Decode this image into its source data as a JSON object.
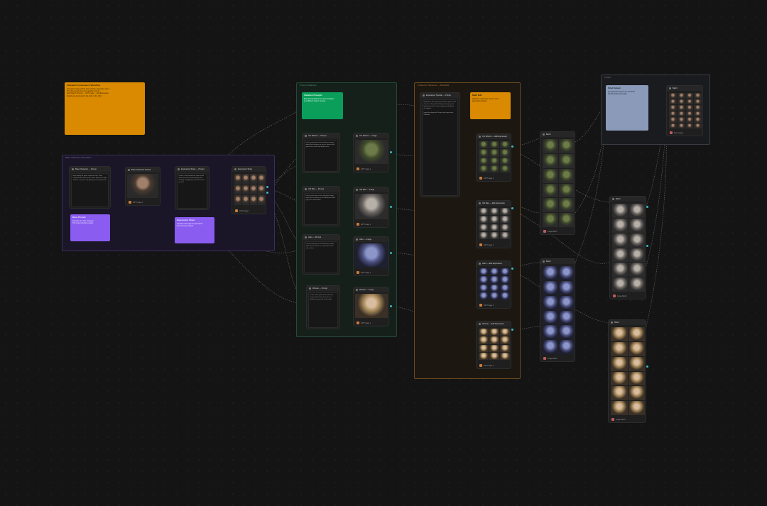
{
  "colors": {
    "background": "#141414",
    "note_orange": "#d98a00",
    "note_green": "#0b9e5a",
    "note_purple": "#8a5cf0",
    "note_blue_gray": "#8a9ab8",
    "group_purple": "#3a2f5a",
    "group_green": "#234a38",
    "group_brown": "#6a4a20",
    "wire": "#8a8a8a",
    "port_cyan": "#3ab8c8"
  },
  "groups": {
    "basic": {
      "title": "Base Character Generation"
    },
    "prompts": {
      "title": "Prompt Variations"
    },
    "edit": {
      "title": "Character Variations — Multi-Edit"
    },
    "output": {
      "title": "Output"
    }
  },
  "notes": {
    "intro": {
      "title": "Character Consistency Workflow",
      "body": "Generate a base portrait, then build an expression sheet.\nThe sheet is fed into every variation prompt.\nEach branch: Prompt → GPT Image → Edit Expression.\nResults are previewed in the grids on the right."
    },
    "base_note_a": {
      "title": "Base Prompt",
      "body": "Describe the main character.\nThis prompt defines identity."
    },
    "base_note_b": {
      "title": "Expression Sheet",
      "body": "Create the 3x4 grid of expressions\nfrom the base portrait."
    },
    "prompt_note": {
      "title": "Variation Prompts",
      "body": "Each prompt places the same character\nin a different style or species."
    },
    "edit_note": {
      "title": "Multi Edit",
      "body": "Apply the expression sheet to each\ngenerated variation."
    },
    "output_note": {
      "title": "Final Output",
      "body": "All expression sheets are combined\ninto the final preview grid."
    }
  },
  "nodes": {
    "base_prompt": {
      "title": "Base Character — Prompt",
      "text": "High quality 4K game character bust. Front facing. Neutral expression. Short brown hair, light stubble, cinematic soft lighting, dark background."
    },
    "base_image": {
      "title": "Base Character Portrait",
      "footer": "GPT Image 1"
    },
    "sheet_prompt": {
      "title": "Expression Sheet — Prompt",
      "text": "Create a 3x4 expression sheet of the same character. Keep identity, hair, clothing and lighting consistent across all cells."
    },
    "sheet_image": {
      "title": "Expression Sheet",
      "footer": "GPT Image 1"
    },
    "orc_prompt": {
      "title": "Orc Warrior — Prompt",
      "text": "In the same style as the reference image, depict the character as an orc warrior with green skin, tusks and battle scars."
    },
    "orc_image": {
      "title": "Orc Warrior — Image",
      "footer": "GPT Image 1"
    },
    "old_prompt": {
      "title": "Old Man — Prompt",
      "text": "In the same style as the reference image, depict the character as an elderly man with grey hair and wrinkles."
    },
    "old_image": {
      "title": "Old Man — Image",
      "footer": "GPT Image 1"
    },
    "alien_prompt": {
      "title": "Alien — Prompt",
      "text": "In the same style as the reference image, depict the character as a pale blue alien with no hair."
    },
    "alien_image": {
      "title": "Alien — Image",
      "footer": "GPT Image 1"
    },
    "woman_prompt": {
      "title": "Woman — Prompt",
      "text": "In the same style as the reference image, depict the character as a blonde woman with a soft smile."
    },
    "woman_image": {
      "title": "Woman — Image",
      "footer": "GPT Image 1"
    },
    "edit_prompt": {
      "title": "Expression Transfer — Prompt",
      "text": "Reproduce the expression sheet using the new character. Keep the 3x4 layout, framing and lighting identical. Only change the identity of the subject.\n\nIgnore background. Keep every expression readable."
    },
    "edit_orc": {
      "title": "Orc Warrior — Edit Expression",
      "footer": "GPT Image 1"
    },
    "edit_old": {
      "title": "Old Man — Edit Expression",
      "footer": "GPT Image 1"
    },
    "edit_alien": {
      "title": "Alien — Edit Expression",
      "footer": "GPT Image 1"
    },
    "edit_woman": {
      "title": "Woman — Edit Expression",
      "footer": "GPT Image 1"
    },
    "preview_1": {
      "title": "Batch",
      "footer": "Image Batch"
    },
    "preview_2": {
      "title": "Batch",
      "footer": "Image Batch"
    },
    "preview_3": {
      "title": "Batch",
      "footer": "Image Batch"
    },
    "preview_4": {
      "title": "Batch",
      "footer": "Image Batch"
    },
    "preview_5": {
      "title": "Batch",
      "footer": "Image Batch"
    },
    "final_grid": {
      "title": "Batch",
      "footer": "Save Image"
    }
  }
}
